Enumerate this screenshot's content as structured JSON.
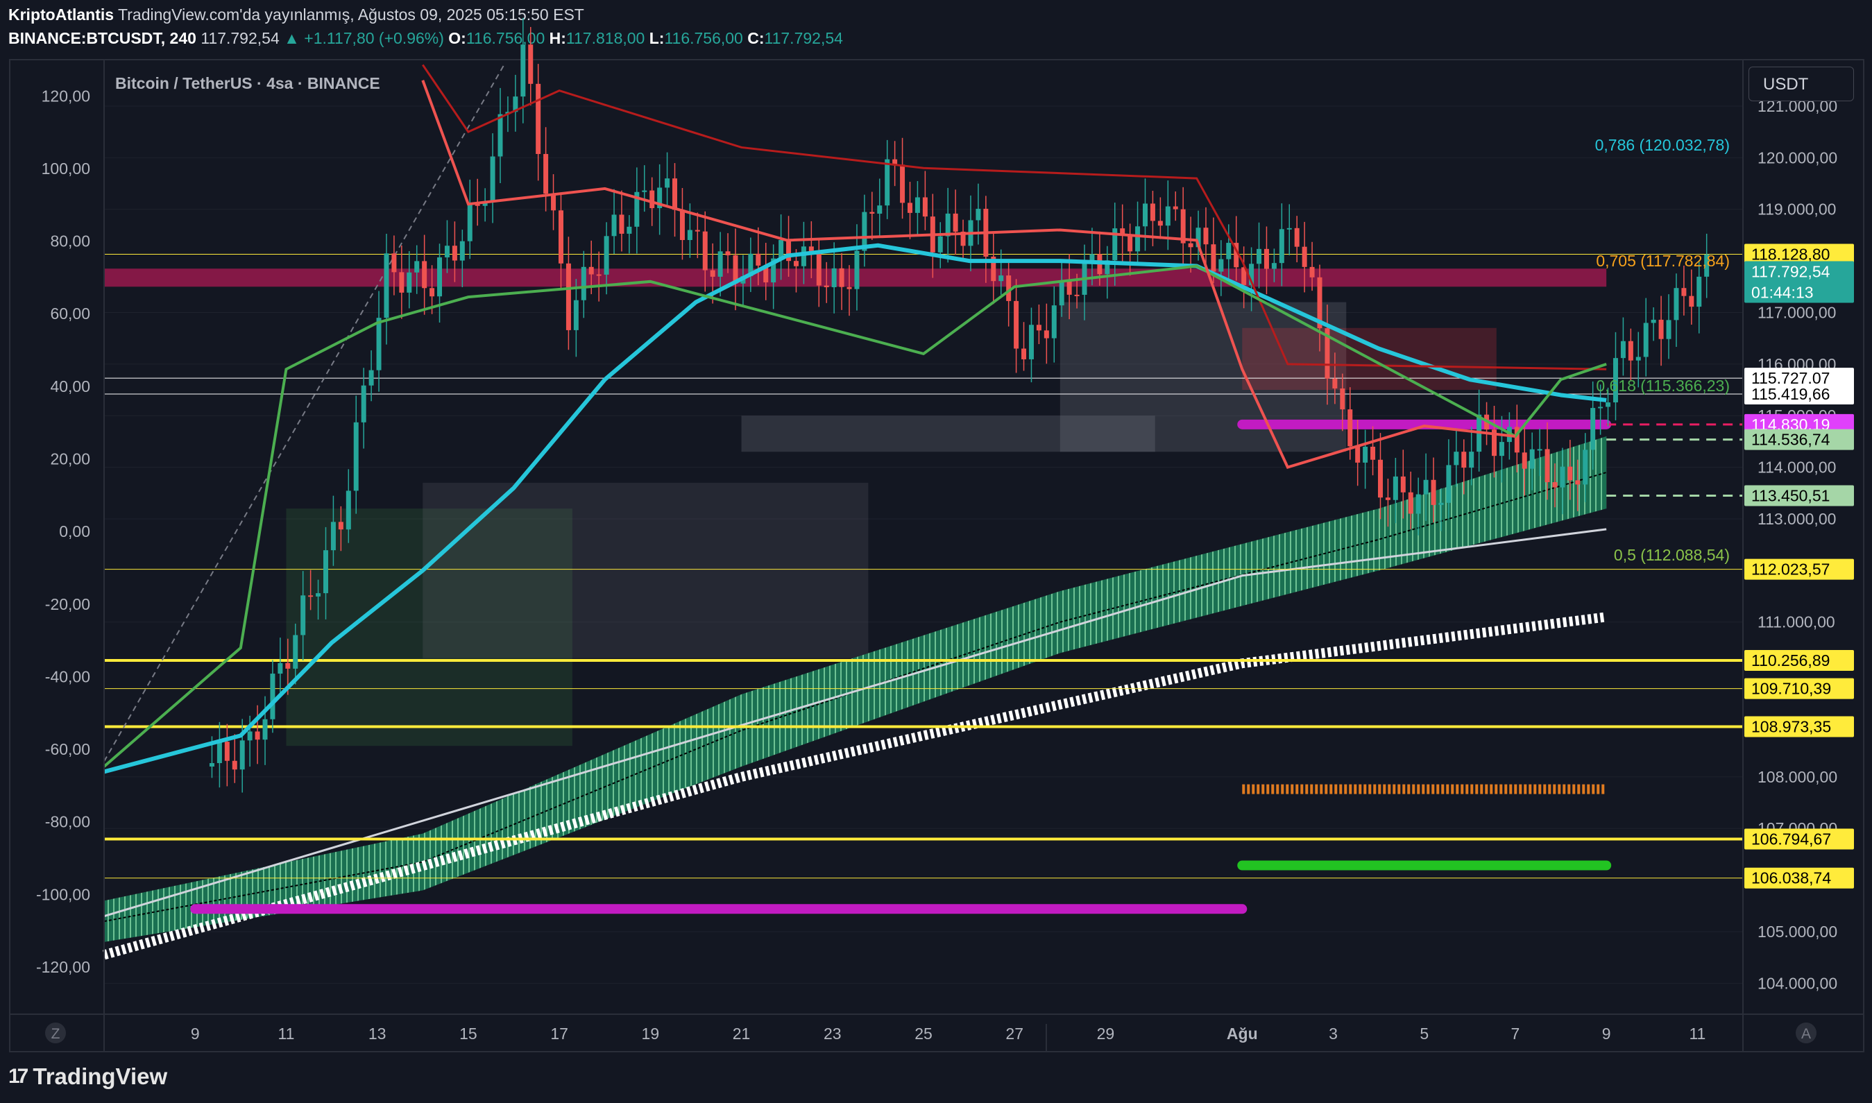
{
  "header": {
    "author": "KriptoAtlantis",
    "published": "TradingView.com'da yayınlanmış, Ağustos 09, 2025 05:15:50 EST",
    "symbol": "BINANCE:BTCUSDT, 240",
    "last": "117.792,54",
    "change": "▲ +1.117,80 (+0.96%)",
    "o_label": "O:",
    "o_value": "116.756,00",
    "h_label": "H:",
    "h_value": "117.818,00",
    "l_label": "L:",
    "l_value": "116.756,00",
    "c_label": "C:",
    "c_value": "117.792,54"
  },
  "chart_title": "Bitcoin / TetherUS · 4sa · BINANCE",
  "currency": "USDT",
  "brand": "TradingView",
  "corner_left": "Z",
  "corner_right": "A",
  "colors": {
    "background": "#131722",
    "grid": "#1e222d",
    "candle_up": "#26a69a",
    "candle_down": "#ef5350",
    "ema": "#26c6da",
    "trail_green": "#4caf50",
    "trail_red": "#f23645",
    "support": "#ffeb3b",
    "magenta": "#c21bc2"
  },
  "chart_data": {
    "type": "candlestick",
    "title": "Bitcoin / TetherUS · 4sa · BINANCE",
    "x_range": [
      "2025-07-07",
      "2025-08-12"
    ],
    "y_ranges": {
      "right_price": [
        103400,
        121900
      ],
      "left_oscillator": [
        -133,
        130
      ]
    },
    "x_ticks": [
      "9",
      "11",
      "13",
      "15",
      "17",
      "19",
      "21",
      "23",
      "25",
      "27",
      "29",
      "Ağu",
      "3",
      "5",
      "7",
      "9",
      "11"
    ],
    "right_ticks": [
      "121.000,00",
      "120.000,00",
      "119.000,00",
      "117.000,00",
      "116.000,00",
      "115.000,00",
      "114.000,00",
      "113.000,00",
      "111.000,00",
      "108.000,00",
      "107.000,00",
      "105.000,00",
      "104.000,00"
    ],
    "right_tick_values": [
      121000,
      120000,
      119000,
      117000,
      116000,
      115000,
      114000,
      113000,
      111000,
      108000,
      107000,
      105000,
      104000
    ],
    "left_ticks": [
      "120,00",
      "100,00",
      "80,00",
      "60,00",
      "40,00",
      "20,00",
      "0,00",
      "-20,00",
      "-40,00",
      "-60,00",
      "-80,00",
      "-100,00",
      "-120,00"
    ],
    "left_tick_values": [
      120,
      100,
      80,
      60,
      40,
      20,
      0,
      -20,
      -40,
      -60,
      -80,
      -100,
      -120
    ],
    "price_badges": [
      {
        "price": 118128.8,
        "text": "118.128,80",
        "style": "yellow"
      },
      {
        "price": 117792.54,
        "text": "117.792,54",
        "sub": "01:44:13",
        "style": "teal"
      },
      {
        "price": 115727.07,
        "text": "115.727,07",
        "style": "white"
      },
      {
        "price": 115419.66,
        "text": "115.419,66",
        "style": "white"
      },
      {
        "price": 114830.19,
        "text": "114.830,19",
        "style": "magenta"
      },
      {
        "price": 114536.74,
        "text": "114.536,74",
        "style": "green"
      },
      {
        "price": 113450.51,
        "text": "113.450,51",
        "style": "green"
      },
      {
        "price": 112023.57,
        "text": "112.023,57",
        "style": "yellow"
      },
      {
        "price": 110256.89,
        "text": "110.256,89",
        "style": "yellow"
      },
      {
        "price": 109710.39,
        "text": "109.710,39",
        "style": "yellow"
      },
      {
        "price": 108973.35,
        "text": "108.973,35",
        "style": "yellow"
      },
      {
        "price": 106794.67,
        "text": "106.794,67",
        "style": "yellow"
      },
      {
        "price": 106038.74,
        "text": "106.038,74",
        "style": "yellow"
      }
    ],
    "fib_levels": [
      {
        "label": "0,786 (120.032,78)",
        "price": 120032.78,
        "color": "#26c6da"
      },
      {
        "label": "0,705 (117.782,84)",
        "price": 117782.84,
        "color": "#f7a21b"
      },
      {
        "label": "0,618 (115.366,23)",
        "price": 115366.23,
        "color": "#4caf50"
      },
      {
        "label": "0,5 (112.088,54)",
        "price": 112088.54,
        "color": "#8bc34a"
      }
    ],
    "horizontal_lines": [
      {
        "price": 118128.8,
        "color": "#ffeb3b",
        "width": 1
      },
      {
        "price": 115727.07,
        "color": "#ffffff",
        "width": 1
      },
      {
        "price": 115419.66,
        "color": "#ffffff",
        "width": 1
      },
      {
        "price": 112023.57,
        "color": "#ffeb3b",
        "width": 1
      },
      {
        "price": 110256.89,
        "color": "#ffeb3b",
        "width": 4
      },
      {
        "price": 109710.39,
        "color": "#ffeb3b",
        "width": 1
      },
      {
        "price": 108973.35,
        "color": "#ffeb3b",
        "width": 4
      },
      {
        "price": 106794.67,
        "color": "#ffeb3b",
        "width": 4
      },
      {
        "price": 106038.74,
        "color": "#ffeb3b",
        "width": 1
      }
    ],
    "price_path": [
      [
        "2025-07-07",
        108200
      ],
      [
        "2025-07-08",
        108600
      ],
      [
        "2025-07-09",
        110800
      ],
      [
        "2025-07-10",
        113000
      ],
      [
        "2025-07-11",
        117800
      ],
      [
        "2025-07-12",
        117600
      ],
      [
        "2025-07-13",
        119000
      ],
      [
        "2025-07-14",
        122000
      ],
      [
        "2025-07-15",
        117000
      ],
      [
        "2025-07-16",
        118600
      ],
      [
        "2025-07-17",
        119500
      ],
      [
        "2025-07-18",
        118000
      ],
      [
        "2025-07-19",
        117800
      ],
      [
        "2025-07-20",
        118200
      ],
      [
        "2025-07-21",
        117400
      ],
      [
        "2025-07-22",
        119800
      ],
      [
        "2025-07-23",
        118500
      ],
      [
        "2025-07-24",
        118700
      ],
      [
        "2025-07-25",
        116200
      ],
      [
        "2025-07-26",
        117500
      ],
      [
        "2025-07-27",
        118300
      ],
      [
        "2025-07-28",
        119000
      ],
      [
        "2025-07-29",
        118200
      ],
      [
        "2025-07-30",
        117800
      ],
      [
        "2025-07-31",
        118600
      ],
      [
        "2025-08-01",
        114800
      ],
      [
        "2025-08-02",
        113500
      ],
      [
        "2025-08-03",
        113400
      ],
      [
        "2025-08-04",
        114700
      ],
      [
        "2025-08-05",
        114300
      ],
      [
        "2025-08-06",
        113600
      ],
      [
        "2025-08-07",
        116000
      ],
      [
        "2025-08-08",
        116800
      ],
      [
        "2025-08-09",
        117792.54
      ]
    ],
    "ema_path": [
      [
        "2025-07-07",
        108100
      ],
      [
        "2025-07-10",
        108800
      ],
      [
        "2025-07-12",
        110600
      ],
      [
        "2025-07-14",
        112000
      ],
      [
        "2025-07-16",
        113600
      ],
      [
        "2025-07-18",
        115700
      ],
      [
        "2025-07-20",
        117200
      ],
      [
        "2025-07-22",
        118100
      ],
      [
        "2025-07-24",
        118300
      ],
      [
        "2025-07-26",
        118000
      ],
      [
        "2025-07-28",
        118000
      ],
      [
        "2025-07-31",
        117900
      ],
      [
        "2025-08-02",
        117100
      ],
      [
        "2025-08-04",
        116300
      ],
      [
        "2025-08-06",
        115700
      ],
      [
        "2025-08-08",
        115400
      ],
      [
        "2025-08-09",
        115300
      ]
    ]
  }
}
